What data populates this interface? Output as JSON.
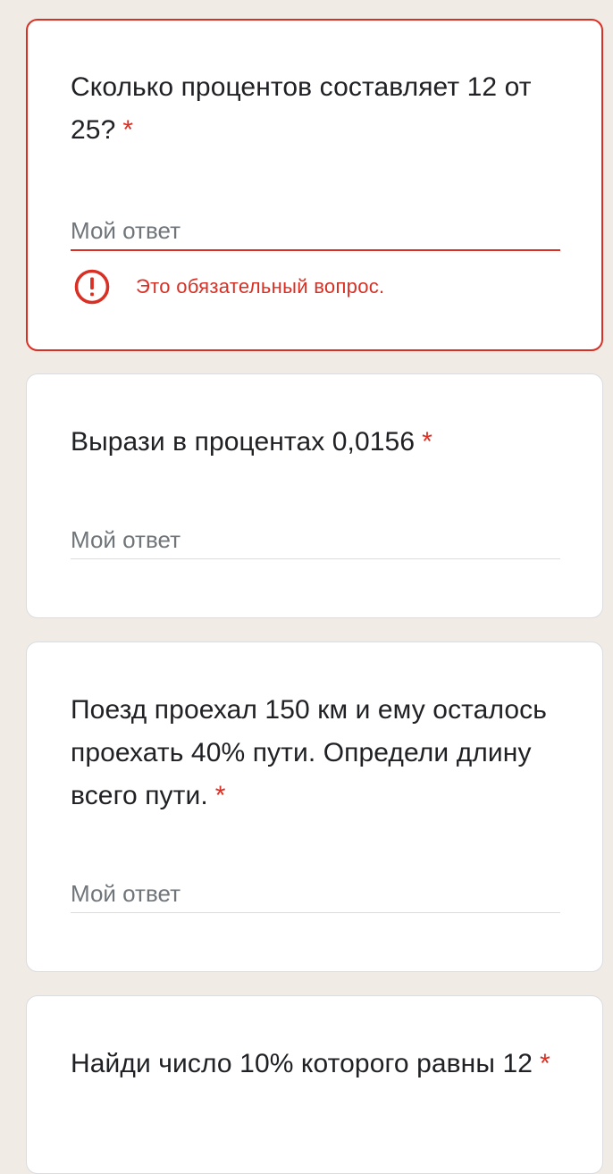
{
  "colors": {
    "page_background": "#f1ebe6",
    "card_background": "#ffffff",
    "error_red": "#d93025",
    "text_primary": "#202124",
    "text_secondary": "#70757a",
    "divider": "#dadce0"
  },
  "required_mark": "*",
  "questions": [
    {
      "text": "Сколько процентов составляет 12 от 25?",
      "placeholder": "Мой ответ",
      "value": "",
      "required": true,
      "error": "Это обязательный вопрос.",
      "error_icon": "exclamation-circle-icon"
    },
    {
      "text": "Вырази в процентах 0,0156",
      "placeholder": "Мой ответ",
      "value": "",
      "required": true
    },
    {
      "text": "Поезд проехал 150 км и ему осталось проехать 40% пути. Определи длину всего пути.",
      "placeholder": "Мой ответ",
      "value": "",
      "required": true
    },
    {
      "text": "Найди число 10% которого равны 12",
      "required": true
    }
  ]
}
